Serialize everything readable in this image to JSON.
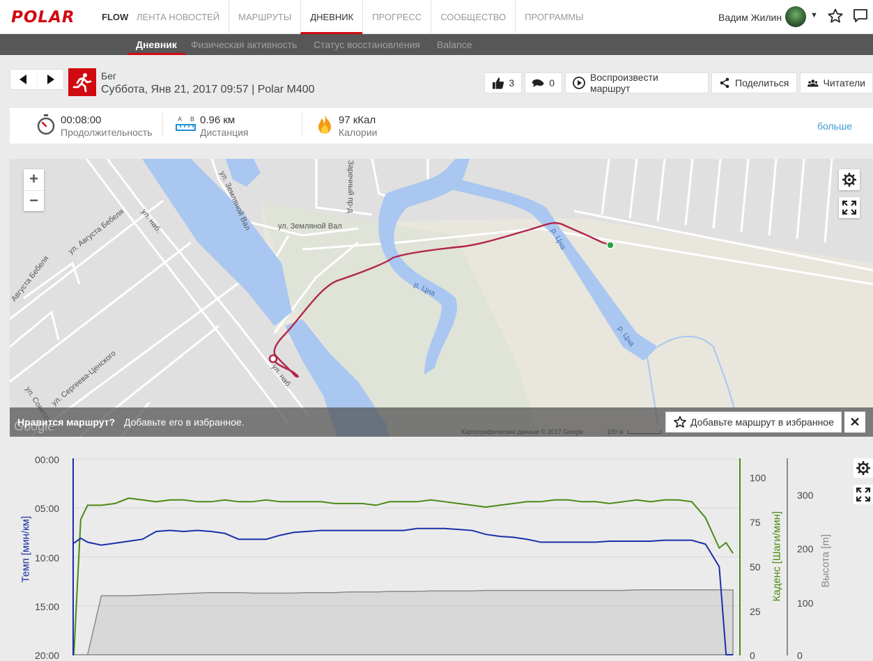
{
  "header": {
    "logo": "POLAR",
    "product": "FLOW",
    "nav": [
      "ЛЕНТА НОВОСТЕЙ",
      "МАРШРУТЫ",
      "ДНЕВНИК",
      "ПРОГРЕСС",
      "СООБЩЕСТВО",
      "ПРОГРАММЫ"
    ],
    "active_nav": "ДНЕВНИК",
    "user_name": "Вадим Жилин"
  },
  "subnav": {
    "items": [
      "Дневник",
      "Физическая активность",
      "Статус восстановления",
      "Balance"
    ],
    "active": "Дневник"
  },
  "session": {
    "sport": "Бег",
    "date_line": "Суббота, Янв 21, 2017 09:57 | Polar M400",
    "likes": "3",
    "comments": "0",
    "replay_label": "Воспроизвести маршрут",
    "share_label": "Поделиться",
    "followers_label": "Читатели"
  },
  "summary": {
    "duration_value": "00:08:00",
    "duration_label": "Продолжительность",
    "distance_value": "0.96 км",
    "distance_label": "Дистанция",
    "distance_icon_a": "A",
    "distance_icon_b": "B",
    "calories_value": "97 кКал",
    "calories_label": "Калории",
    "more": "больше"
  },
  "map": {
    "labels": {
      "street_zemlyanoy_val_1": "ул. Земляной Вал",
      "street_zemlyanoy_val_2": "ул. Земляной Вал",
      "street_zarechny": "Заречный пр-д",
      "street_avgusta_bebelya": "ул. Августа Бебеля",
      "street_bebelya": "Августа Бебеля",
      "street_nab_1": "ул. наб.",
      "street_nab_2": "ул. наб.",
      "street_sergeeva": "ул. Сергеева-Ценского",
      "street_sovetskaya": "ул. Советская",
      "river_1": "р. Цна",
      "river_2": "р. Цна",
      "river_3": "р. Цна"
    },
    "fav_question": "Нравится маршрут?",
    "fav_text": "Добавьте его в избранное.",
    "fav_button": "Добавьте маршрут в избранное",
    "attribution": "Картографические данные © 2017 Google",
    "scale": "100 м",
    "google_logo": "Google"
  },
  "chart": {
    "left_axis_label": "Темп [мин/км]",
    "cadence_axis_label": "Каденс [Шаги/мин]",
    "altitude_axis_label": "Высота [m]",
    "pace_ticks": [
      "00:00",
      "05:00",
      "10:00",
      "15:00",
      "20:00"
    ],
    "cadence_ticks": [
      "100",
      "75",
      "50",
      "25",
      "0"
    ],
    "altitude_ticks": [
      "300",
      "200",
      "100",
      "0"
    ]
  },
  "chart_data": {
    "type": "line",
    "x": [
      0,
      0.5,
      1,
      2,
      3,
      4,
      5,
      6,
      7,
      8,
      9,
      10,
      11,
      12,
      13,
      14,
      15,
      16,
      17,
      18,
      19,
      20,
      21,
      22,
      23,
      24,
      25,
      26,
      27,
      28,
      29,
      30,
      31,
      32,
      33,
      34,
      35,
      36,
      37,
      38,
      39,
      40,
      41,
      42,
      43,
      44,
      45,
      46,
      47,
      47.5,
      48
    ],
    "series": [
      {
        "axis": "pace_min_per_km",
        "color": "#1a2fa8",
        "values": [
          8.6,
          8.1,
          8.5,
          8.8,
          8.6,
          8.4,
          8.2,
          7.4,
          7.3,
          7.4,
          7.3,
          7.4,
          7.6,
          8.2,
          8.2,
          8.2,
          7.8,
          7.5,
          7.4,
          7.3,
          7.3,
          7.3,
          7.3,
          7.3,
          7.3,
          7.3,
          7.1,
          7.1,
          7.1,
          7.2,
          7.3,
          7.7,
          7.9,
          8.0,
          8.2,
          8.5,
          8.5,
          8.5,
          8.5,
          8.5,
          8.4,
          8.4,
          8.4,
          8.4,
          8.3,
          8.3,
          8.3,
          8.7,
          11.0,
          20.0,
          20.0
        ]
      },
      {
        "axis": "cadence_steps_per_min",
        "color": "#4a8a14",
        "values": [
          0,
          76,
          84,
          84,
          85,
          88,
          87,
          86,
          87,
          87,
          86,
          86,
          87,
          86,
          86,
          87,
          86,
          86,
          86,
          86,
          85,
          85,
          85,
          84,
          86,
          86,
          86,
          87,
          86,
          85,
          84,
          83,
          84,
          85,
          86,
          86,
          87,
          87,
          86,
          86,
          85,
          86,
          87,
          86,
          87,
          87,
          86,
          77,
          60,
          63,
          57
        ]
      },
      {
        "axis": "altitude_m",
        "color": "#8a8a8a",
        "values": [
          0,
          0,
          0,
          110,
          110,
          110,
          111,
          112,
          113,
          114,
          115,
          116,
          116,
          116,
          115,
          115,
          115,
          115,
          116,
          116,
          116,
          117,
          117,
          117,
          118,
          118,
          118,
          119,
          119,
          119,
          119,
          120,
          120,
          120,
          120,
          120,
          120,
          120,
          120,
          120,
          120,
          120,
          121,
          121,
          121,
          121,
          121,
          121,
          121,
          121,
          121
        ]
      }
    ],
    "ylim_pace": [
      0,
      20
    ],
    "ylim_cadence": [
      0,
      110
    ],
    "ylim_altitude": [
      0,
      365
    ]
  }
}
